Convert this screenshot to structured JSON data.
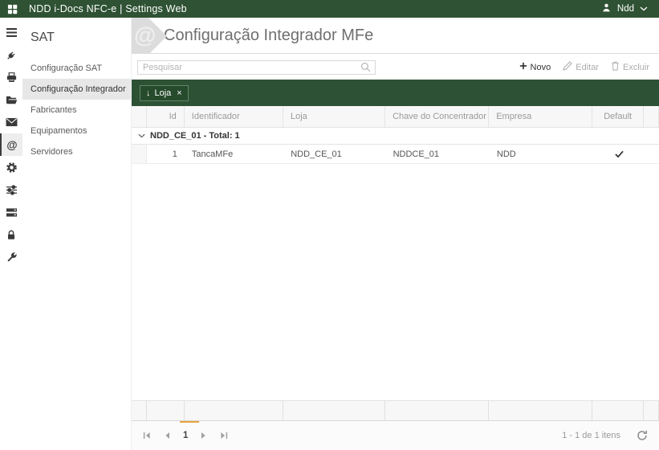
{
  "colors": {
    "topbar_green": "#2e5233",
    "group_bar_green": "#2d5134",
    "chip_green": "#264a2c",
    "page_indicator_orange": "#e8a33d"
  },
  "topbar": {
    "title": "NDD i-Docs NFC-e | Settings Web",
    "user_label": "Ndd"
  },
  "icon_rail": {
    "icons": [
      "menu-icon",
      "plug-icon",
      "printer-icon",
      "folder-icon",
      "mail-icon",
      "at-icon",
      "gear-icon",
      "sliders-icon",
      "server-icon",
      "lock-icon",
      "wrench-icon"
    ],
    "active_icon": "at-icon",
    "at_glyph": "@"
  },
  "sidebar": {
    "title": "SAT",
    "items": [
      {
        "label": "Configuração SAT",
        "active": false
      },
      {
        "label": "Configuração Integrador",
        "active": true
      },
      {
        "label": "Fabricantes",
        "active": false
      },
      {
        "label": "Equipamentos",
        "active": false
      },
      {
        "label": "Servidores",
        "active": false
      }
    ]
  },
  "page": {
    "title": "Configuração Integrador MFe",
    "watermark_glyph": "@"
  },
  "toolbar": {
    "search_placeholder": "Pesquisar",
    "new_label": "Novo",
    "edit_label": "Editar",
    "delete_label": "Excluir"
  },
  "grid": {
    "group_chip": {
      "sort_glyph": "↓",
      "label": "Loja",
      "close_glyph": "×"
    },
    "columns": {
      "id": "Id",
      "identificador": "Identificador",
      "loja": "Loja",
      "chave": "Chave do Concentrador",
      "empresa": "Empresa",
      "default": "Default"
    },
    "group_header": "NDD_CE_01 - Total: 1",
    "rows": [
      {
        "id": "1",
        "identificador": "TancaMFe",
        "loja": "NDD_CE_01",
        "chave": "NDDCE_01",
        "empresa": "NDD",
        "is_default": true
      }
    ],
    "pager": {
      "current_page": "1",
      "info": "1 - 1 de 1 itens"
    }
  }
}
